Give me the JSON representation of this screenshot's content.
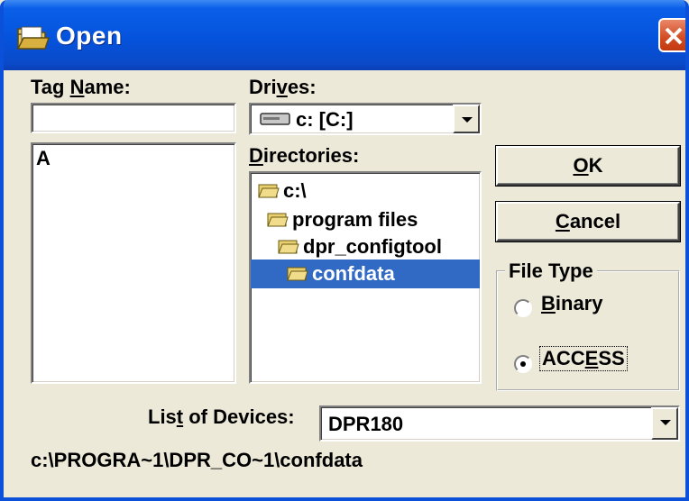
{
  "window": {
    "title": "Open",
    "close_label": "×"
  },
  "tag_name": {
    "label_pre": "Tag ",
    "label_ul": "N",
    "label_post": "ame:",
    "value": "",
    "list": [
      "A"
    ]
  },
  "drives": {
    "label_pre": "Dri",
    "label_ul": "v",
    "label_post": "es:",
    "selected": "c: [C:]"
  },
  "directories": {
    "label_ul": "D",
    "label_post": "irectories:",
    "items": [
      {
        "name": "c:\\",
        "selected": false
      },
      {
        "name": "program files",
        "selected": false
      },
      {
        "name": "dpr_configtool",
        "selected": false
      },
      {
        "name": "confdata",
        "selected": true
      }
    ]
  },
  "buttons": {
    "ok_ul": "O",
    "ok_post": "K",
    "cancel_ul": "C",
    "cancel_post": "ancel"
  },
  "file_type": {
    "title": "File Type",
    "binary_ul": "B",
    "binary_post": "inary",
    "access_pre": "ACC",
    "access_ul": "E",
    "access_post": "SS",
    "selected": "ACCESS"
  },
  "devices": {
    "label_pre": "Lis",
    "label_ul": "t",
    "label_post": " of Devices:",
    "selected": "DPR180"
  },
  "path": "c:\\PROGRA~1\\DPR_CO~1\\confdata",
  "colors": {
    "title_bar": "#0553dc",
    "selection": "#316ac5",
    "face": "#ece9d8"
  }
}
